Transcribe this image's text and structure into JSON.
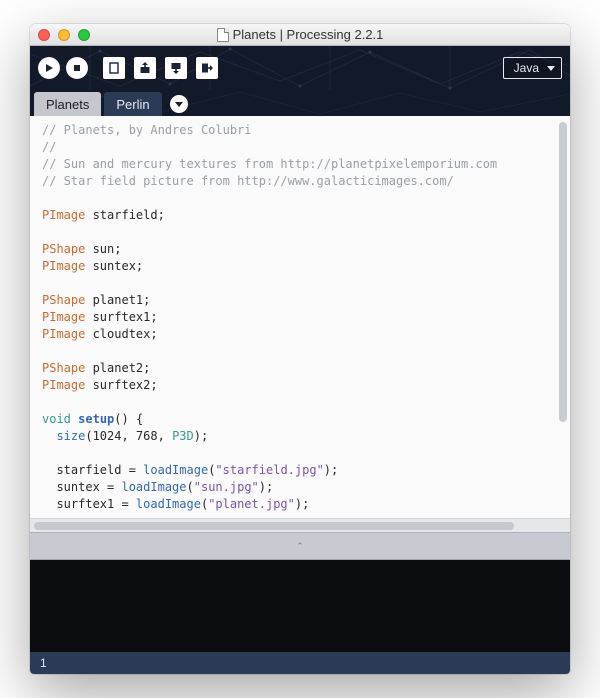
{
  "titlebar": {
    "title": "Planets | Processing 2.2.1"
  },
  "toolbar": {
    "mode_label": "Java"
  },
  "tabs": [
    {
      "label": "Planets",
      "active": true
    },
    {
      "label": "Perlin",
      "active": false
    }
  ],
  "code": {
    "lines": [
      {
        "t": "comment",
        "text": "// Planets, by Andres Colubri"
      },
      {
        "t": "comment",
        "text": "//"
      },
      {
        "t": "comment",
        "text": "// Sun and mercury textures from http://planetpixelemporium.com"
      },
      {
        "t": "comment",
        "text": "// Star field picture from http://www.galacticimages.com/"
      },
      {
        "t": "blank"
      },
      {
        "t": "decl",
        "type": "PImage",
        "name": "starfield"
      },
      {
        "t": "blank"
      },
      {
        "t": "decl",
        "type": "PShape",
        "name": "sun"
      },
      {
        "t": "decl",
        "type": "PImage",
        "name": "suntex"
      },
      {
        "t": "blank"
      },
      {
        "t": "decl",
        "type": "PShape",
        "name": "planet1"
      },
      {
        "t": "decl",
        "type": "PImage",
        "name": "surftex1"
      },
      {
        "t": "decl",
        "type": "PImage",
        "name": "cloudtex"
      },
      {
        "t": "blank"
      },
      {
        "t": "decl",
        "type": "PShape",
        "name": "planet2"
      },
      {
        "t": "decl",
        "type": "PImage",
        "name": "surftex2"
      },
      {
        "t": "blank"
      },
      {
        "t": "func_open",
        "ret": "void",
        "name": "setup"
      },
      {
        "t": "size_call",
        "w": "1024",
        "h": "768",
        "mode": "P3D"
      },
      {
        "t": "blank"
      },
      {
        "t": "load",
        "var": "starfield",
        "fn": "loadImage",
        "arg": "\"starfield.jpg\""
      },
      {
        "t": "load",
        "var": "suntex",
        "fn": "loadImage",
        "arg": "\"sun.jpg\""
      },
      {
        "t": "load",
        "var": "surftex1",
        "fn": "loadImage",
        "arg": "\"planet.jpg\""
      }
    ]
  },
  "status": {
    "line": "1"
  }
}
